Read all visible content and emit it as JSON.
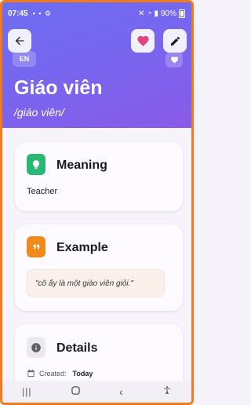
{
  "status_bar": {
    "time": "07:45",
    "battery": "90%"
  },
  "header": {
    "language": "EN",
    "word": "Giáo viên",
    "phonetic": "/giáo viên/"
  },
  "meaning": {
    "title": "Meaning",
    "text": "Teacher"
  },
  "example": {
    "title": "Example",
    "text": "\"cô ấy là một giáo viên giỏi.\""
  },
  "details": {
    "title": "Details",
    "created_label": "Created:",
    "created_value": "Today"
  },
  "colors": {
    "header_gradient_start": "#6d6ef2",
    "header_gradient_end": "#8a5ae8",
    "favorite_pink": "#e0457b",
    "meaning_icon_green": "#2bb673",
    "example_icon_orange": "#f08a1c"
  }
}
